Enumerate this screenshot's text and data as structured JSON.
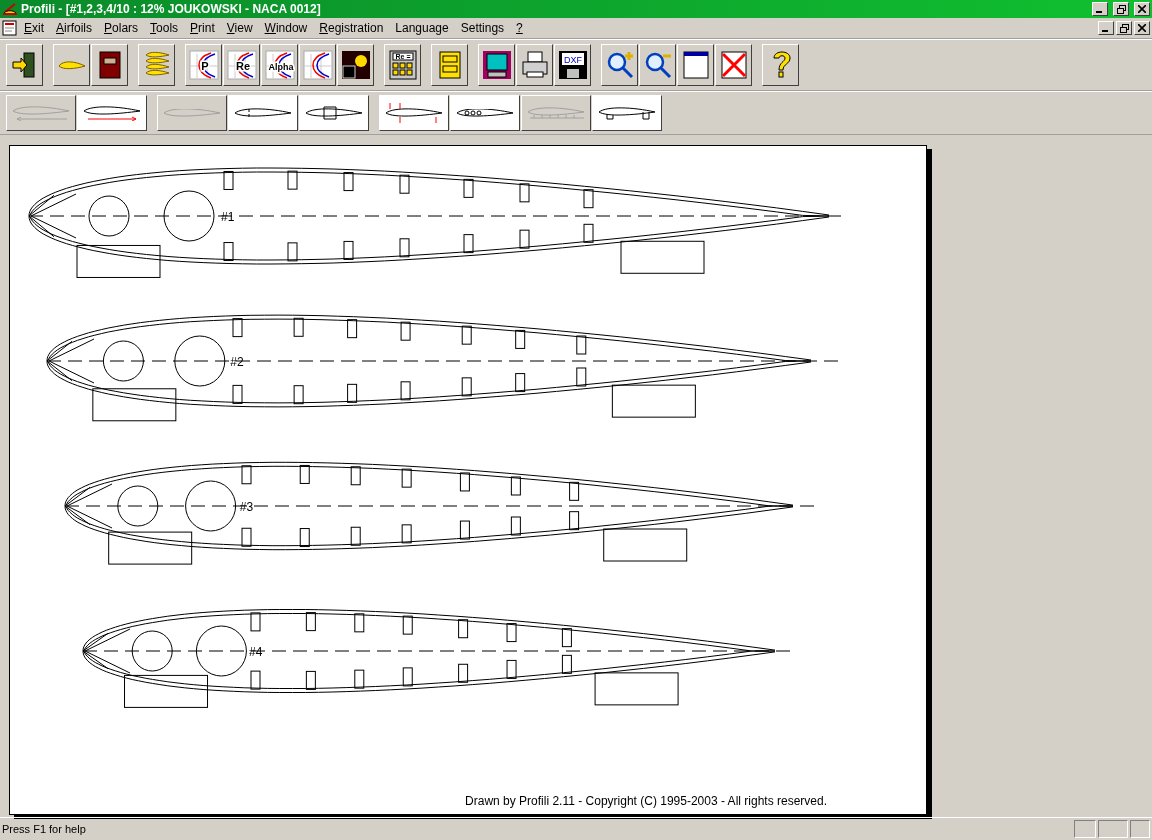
{
  "window": {
    "title": "Profili - [#1,2,3,4/10 : 12% JOUKOWSKI - NACA 0012]"
  },
  "menu": [
    {
      "label": "Exit",
      "underlined": true
    },
    {
      "label": "Airfoils",
      "underlined": true
    },
    {
      "label": "Polars",
      "underlined": true
    },
    {
      "label": "Tools",
      "underlined": true
    },
    {
      "label": "Print",
      "underlined": true
    },
    {
      "label": "View",
      "underlined": true
    },
    {
      "label": "Window",
      "underlined": true
    },
    {
      "label": "Registration",
      "underlined": true
    },
    {
      "label": "Language",
      "underlined": false
    },
    {
      "label": "Settings",
      "underlined": false
    },
    {
      "label": "?",
      "underlined": true
    }
  ],
  "toolbar": [
    [
      {
        "kind": "exit"
      }
    ],
    [
      {
        "kind": "airfoil"
      },
      {
        "kind": "book"
      }
    ],
    [
      {
        "kind": "stack"
      }
    ],
    [
      {
        "kind": "polar",
        "label": "P"
      },
      {
        "kind": "polar",
        "label": "Re"
      },
      {
        "kind": "polar",
        "label": "Alpha"
      },
      {
        "kind": "polar"
      },
      {
        "kind": "panel"
      }
    ],
    [
      {
        "kind": "calculator",
        "label": "Re ="
      }
    ],
    [
      {
        "kind": "cabinet"
      }
    ],
    [
      {
        "kind": "monitor"
      },
      {
        "kind": "printer"
      },
      {
        "kind": "floppy",
        "label": "DXF"
      }
    ],
    [
      {
        "kind": "zoom_in"
      },
      {
        "kind": "zoom_out"
      },
      {
        "kind": "window"
      },
      {
        "kind": "cross"
      }
    ],
    [
      {
        "kind": "help"
      }
    ]
  ],
  "rib_toolbar": [
    [
      {
        "kind": "arrows",
        "disabled": true
      },
      {
        "kind": "arrow_line",
        "disabled": false
      }
    ],
    [
      {
        "kind": "plain",
        "disabled": true
      },
      {
        "kind": "notched",
        "disabled": false
      },
      {
        "kind": "nose",
        "disabled": false
      }
    ],
    [
      {
        "kind": "forces",
        "disabled": false
      },
      {
        "kind": "holes",
        "disabled": false
      },
      {
        "kind": "ruler",
        "disabled": true
      },
      {
        "kind": "feet",
        "disabled": false
      }
    ]
  ],
  "drawing": {
    "ribs": [
      {
        "label": "#1"
      },
      {
        "label": "#2"
      },
      {
        "label": "#3"
      },
      {
        "label": "#4"
      }
    ],
    "footer": "Drawn by Profili 2.11 - Copyright (C) 1995-2003 - All rights reserved."
  },
  "status_bar": {
    "text": "Press F1 for help"
  }
}
